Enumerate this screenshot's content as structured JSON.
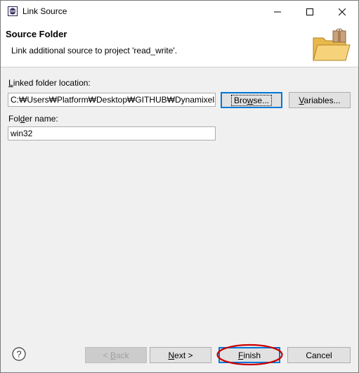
{
  "window": {
    "title": "Link Source"
  },
  "header": {
    "title": "Source Folder",
    "description": "Link additional source to project 'read_write'."
  },
  "form": {
    "location_label": "Linked folder location:",
    "location_value": "C:₩Users₩Platform₩Desktop₩GITHUB₩DynamixelSD",
    "browse_label": "Browse...",
    "variables_label": "Variables...",
    "name_label": "Folder name:",
    "name_value": "win32"
  },
  "footer": {
    "back_label": "< Back",
    "next_label": "Next >",
    "finish_label": "Finish",
    "cancel_label": "Cancel"
  },
  "colors": {
    "annotation": "#cc0000",
    "focus": "#0078d7"
  }
}
